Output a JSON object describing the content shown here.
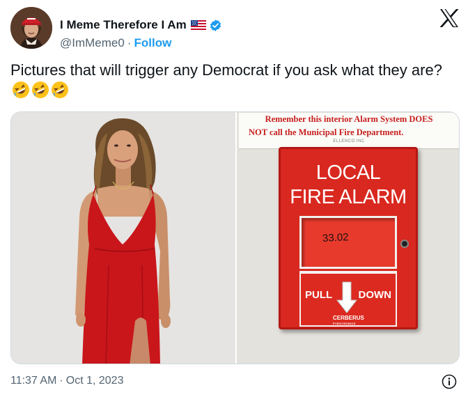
{
  "author": {
    "display_name": "I Meme Therefore I Am",
    "handle": "@ImMeme0",
    "separator": "·",
    "follow_label": "Follow",
    "flag_icon": "us-flag-icon",
    "verified_icon": "verified-badge-icon",
    "verified_color": "#1d9bf0"
  },
  "platform_icon": "x-logo-icon",
  "tweet": {
    "text": "Pictures that will trigger any Democrat if you ask what they are?",
    "emojis": [
      "rolling-on-floor-laughing-emoji",
      "rolling-on-floor-laughing-emoji",
      "rolling-on-floor-laughing-emoji"
    ]
  },
  "media": {
    "left_image": "woman-in-red-dress-photo",
    "right_image": "fire-alarm-pull-station-photo",
    "sign": {
      "line1": "Remember this interior Alarm System DOES",
      "line2": "NOT call the Municipal Fire Department.",
      "small": "ELLENCO INC"
    },
    "alarm": {
      "title_line1": "LOCAL",
      "title_line2": "FIRE ALARM",
      "window_code": "33.02",
      "pull_label": "PULL",
      "down_label": "DOWN",
      "brand": "CERBERUS",
      "brand_sub": "PYROTRONICS"
    }
  },
  "footer": {
    "time": "11:37 AM",
    "separator": "·",
    "date": "Oct 1, 2023",
    "info_icon": "info-icon"
  },
  "colors": {
    "text": "#0f1419",
    "secondary": "#536471",
    "link": "#1d9bf0",
    "alarm_red": "#d9281f",
    "dress_red": "#c9161b"
  }
}
